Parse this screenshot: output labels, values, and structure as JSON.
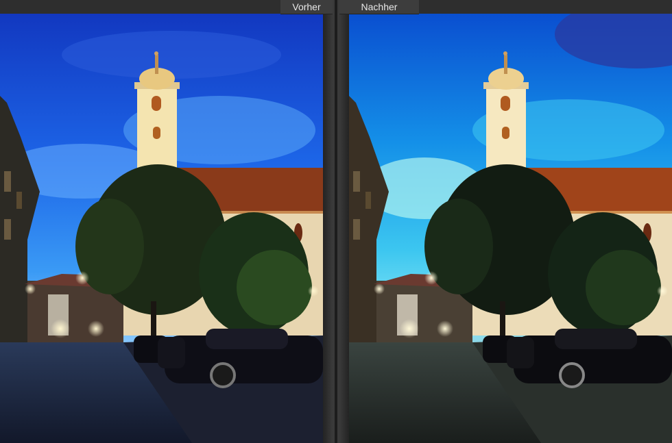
{
  "before_label": "Vorher",
  "after_label": "Nachher",
  "colors": {
    "background": "#2e2e2e",
    "tab_background": "#3d3d3d",
    "tab_text": "#e8e8e8",
    "before_sky_top": "#1440c8",
    "after_sky_top": "#0a6fd8"
  },
  "icons": {
    "before_photo": "photo-preview",
    "after_photo": "photo-preview"
  }
}
